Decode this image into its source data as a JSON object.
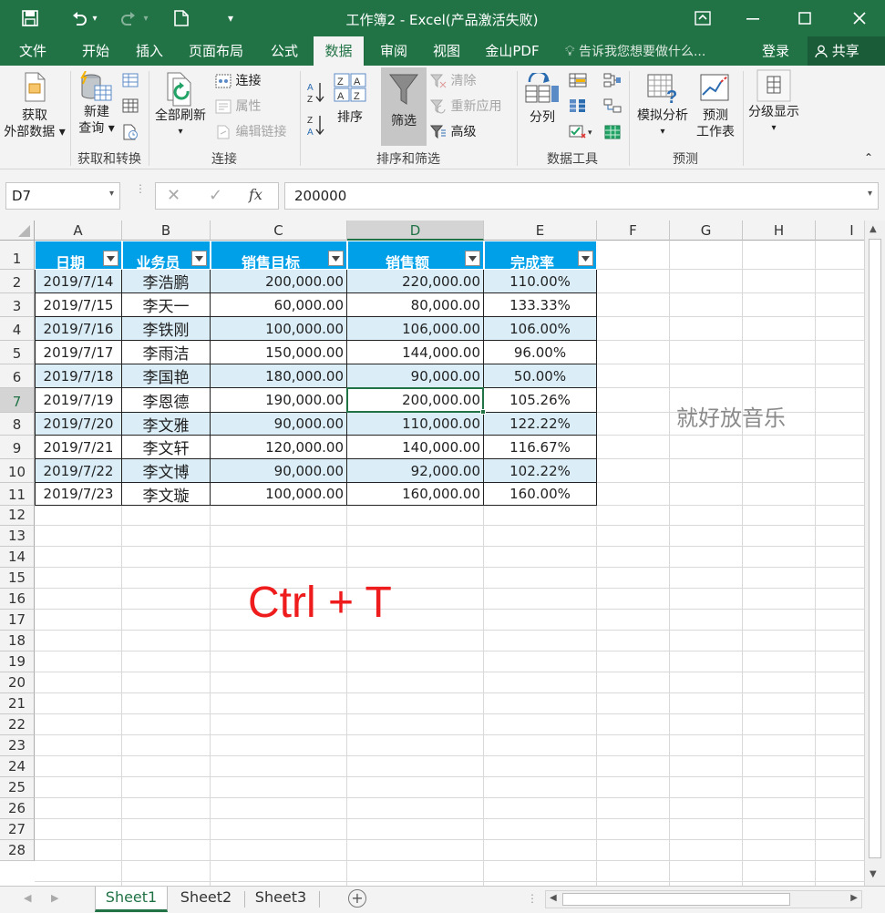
{
  "window": {
    "title": "工作簿2 - Excel(产品激活失败)"
  },
  "ribbon_tabs": [
    "文件",
    "开始",
    "插入",
    "页面布局",
    "公式",
    "数据",
    "审阅",
    "视图",
    "金山PDF"
  ],
  "tell_me": "告诉我您想要做什么...",
  "login": "登录",
  "share": "共享",
  "ribbon": {
    "get_external_1": "获取",
    "get_external_2": "外部数据",
    "new_query_1": "新建",
    "new_query_2": "查询",
    "group_get_transform": "获取和转换",
    "refresh_all": "全部刷新",
    "connections": "连接",
    "properties": "属性",
    "edit_links": "编辑链接",
    "group_connections": "连接",
    "sort": "排序",
    "filter": "筛选",
    "clear": "清除",
    "reapply": "重新应用",
    "advanced": "高级",
    "group_sort_filter": "排序和筛选",
    "text_to_columns": "分列",
    "group_data_tools": "数据工具",
    "what_if": "模拟分析",
    "forecast_sheet_1": "预测",
    "forecast_sheet_2": "工作表",
    "group_forecast": "预测",
    "outline": "分级显示"
  },
  "formula_bar": {
    "name_box": "D7",
    "fx_label": "fx",
    "value": "200000"
  },
  "columns": [
    "A",
    "B",
    "C",
    "D",
    "E",
    "F",
    "G",
    "H",
    "I"
  ],
  "rows": [
    "1",
    "2",
    "3",
    "4",
    "5",
    "6",
    "7",
    "8",
    "9",
    "10",
    "11",
    "12",
    "13",
    "14",
    "15",
    "16",
    "17",
    "18",
    "19",
    "20",
    "21",
    "22",
    "23",
    "24",
    "25",
    "26",
    "27",
    "28"
  ],
  "table": {
    "headers": [
      "日期",
      "业务员",
      "销售目标",
      "销售额",
      "完成率"
    ],
    "rows": [
      [
        "2019/7/14",
        "李浩鹏",
        "200,000.00",
        "220,000.00",
        "110.00%"
      ],
      [
        "2019/7/15",
        "李天一",
        "60,000.00",
        "80,000.00",
        "133.33%"
      ],
      [
        "2019/7/16",
        "李铁刚",
        "100,000.00",
        "106,000.00",
        "106.00%"
      ],
      [
        "2019/7/17",
        "李雨洁",
        "150,000.00",
        "144,000.00",
        "96.00%"
      ],
      [
        "2019/7/18",
        "李国艳",
        "180,000.00",
        "90,000.00",
        "50.00%"
      ],
      [
        "2019/7/19",
        "李恩德",
        "190,000.00",
        "200,000.00",
        "105.26%"
      ],
      [
        "2019/7/20",
        "李文雅",
        "90,000.00",
        "110,000.00",
        "122.22%"
      ],
      [
        "2019/7/21",
        "李文轩",
        "120,000.00",
        "140,000.00",
        "116.67%"
      ],
      [
        "2019/7/22",
        "李文博",
        "90,000.00",
        "92,000.00",
        "102.22%"
      ],
      [
        "2019/7/23",
        "李文璇",
        "100,000.00",
        "160,000.00",
        "160.00%"
      ]
    ]
  },
  "annotations": {
    "shortcut": "Ctrl + T",
    "music_note": "就好放音乐"
  },
  "sheet_tabs": [
    "Sheet1",
    "Sheet2",
    "Sheet3"
  ],
  "colors": {
    "excel_green": "#217346",
    "table_header": "#00a0e9",
    "band": "#dbeef8",
    "shortcut_red": "#ee1c1c"
  }
}
